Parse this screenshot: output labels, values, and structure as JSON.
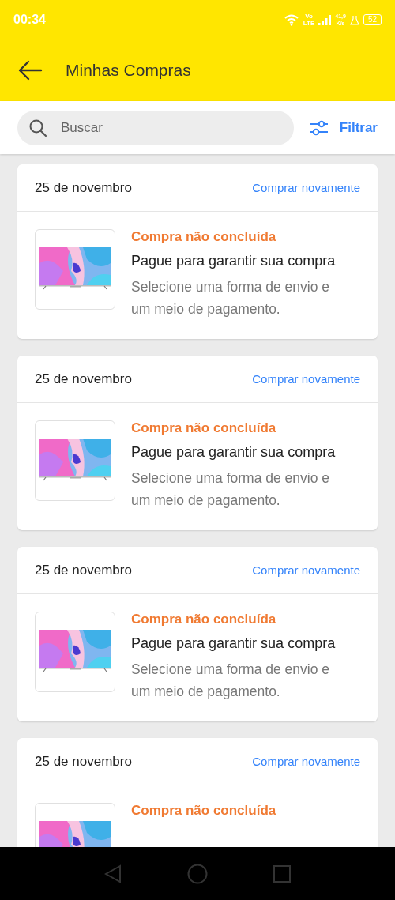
{
  "status_bar": {
    "time": "00:34",
    "network": "Vo LTE",
    "speed": "41,9 K/s",
    "battery": "52"
  },
  "header": {
    "title": "Minhas Compras"
  },
  "search": {
    "placeholder": "Buscar",
    "filter_label": "Filtrar"
  },
  "orders": [
    {
      "date": "25 de novembro",
      "action": "Comprar novamente",
      "status": "Compra não concluída",
      "message": "Pague para garantir sua compra",
      "detail": "Selecione uma forma de envio e um meio de pagamento."
    },
    {
      "date": "25 de novembro",
      "action": "Comprar novamente",
      "status": "Compra não concluída",
      "message": "Pague para garantir sua compra",
      "detail": "Selecione uma forma de envio e um meio de pagamento."
    },
    {
      "date": "25 de novembro",
      "action": "Comprar novamente",
      "status": "Compra não concluída",
      "message": "Pague para garantir sua compra",
      "detail": "Selecione uma forma de envio e um meio de pagamento."
    },
    {
      "date": "25 de novembro",
      "action": "Comprar novamente",
      "status": "Compra não concluída"
    }
  ]
}
